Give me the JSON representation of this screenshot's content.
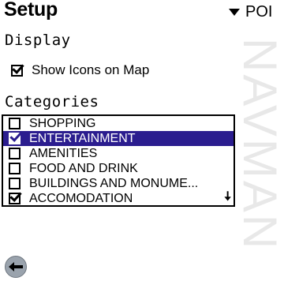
{
  "header": {
    "title": "Setup",
    "menu_label": "POI"
  },
  "display": {
    "label": "Display",
    "show_icons_label": "Show Icons on Map",
    "show_icons_checked": true
  },
  "categories": {
    "label": "Categories",
    "items": [
      {
        "label": "SHOPPING",
        "checked": false,
        "selected": false
      },
      {
        "label": "ENTERTAINMENT",
        "checked": true,
        "selected": true
      },
      {
        "label": "AMENITIES",
        "checked": false,
        "selected": false
      },
      {
        "label": "FOOD AND DRINK",
        "checked": false,
        "selected": false
      },
      {
        "label": "BUILDINGS AND MONUME...",
        "checked": false,
        "selected": false
      },
      {
        "label": "ACCOMODATION",
        "checked": true,
        "selected": false
      }
    ]
  },
  "watermark": "NAVMAN",
  "colors": {
    "selection": "#2b1d8f",
    "back_button": "#9aa3ad"
  },
  "icons": {
    "menu": "triangle-down-icon",
    "scroll": "arrow-down-icon",
    "back": "back-arrow-icon"
  }
}
